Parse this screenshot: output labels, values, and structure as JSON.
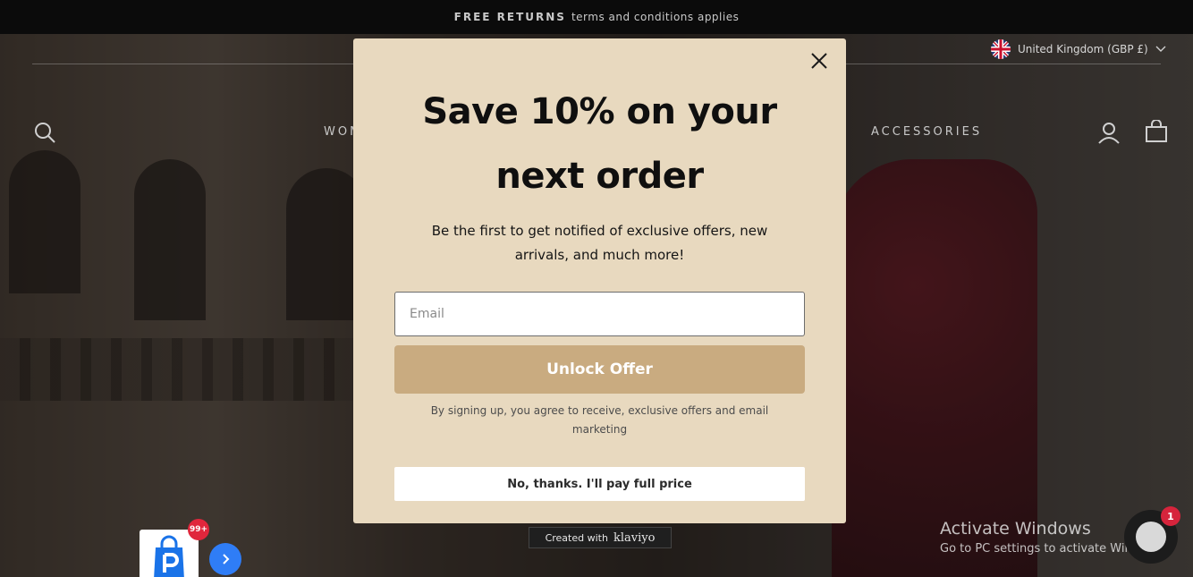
{
  "announcement": {
    "strong": "FREE RETURNS",
    "text": "terms and conditions applies"
  },
  "locale": {
    "label": "United Kingdom (GBP £)",
    "flag_icon": "uk-flag-icon"
  },
  "nav": {
    "left_item": "WOM",
    "right_item": "ACCESSORIES"
  },
  "popup": {
    "headline_line1": "Save 10% on your",
    "headline_line2": "next order",
    "subtext": "Be the first to get notified of exclusive offers, new arrivals, and much more!",
    "email_placeholder": "Email",
    "cta_label": "Unlock Offer",
    "legal": "By signing up, you agree to receive, exclusive offers and email marketing",
    "decline_label": "No, thanks. I'll pay full price",
    "accent_color": "#c9ab80",
    "background_color": "#e8d9bf"
  },
  "klaviyo": {
    "prefix": "Created with",
    "brand": "klaviyo"
  },
  "app_widget": {
    "badge": "99+"
  },
  "chat": {
    "badge": "1"
  },
  "watermark": {
    "line1": "Activate Windows",
    "line2": "Go to PC settings to activate Windows."
  }
}
